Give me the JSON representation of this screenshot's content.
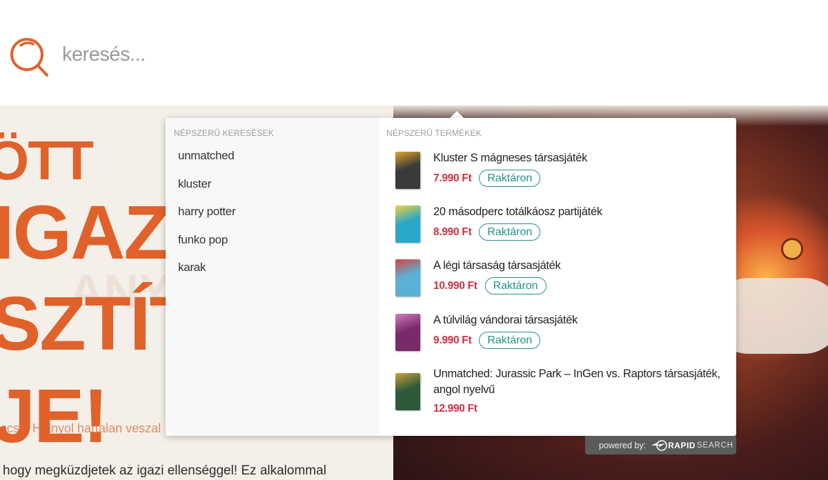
{
  "search": {
    "placeholder": "keresés..."
  },
  "hero": {
    "line1": "ÖTT",
    "line2": "IGAZI",
    "line3": "SZTÍTA",
    "line4": "JE!",
    "ghost": "ANY",
    "small_text": "ocsk. Hianyol hartalan veszal",
    "body_text": "hogy megküzdjetek az igazi ellenséggel! Ez alkalommal"
  },
  "dropdown": {
    "popular_searches_title": "NÉPSZERŰ KERESÉSEK",
    "popular_searches": [
      "unmatched",
      "kluster",
      "harry potter",
      "funko pop",
      "karak"
    ],
    "popular_products_title": "NÉPSZERŰ TERMÉKEK",
    "products": [
      {
        "name": "Kluster S mágneses társasjáték",
        "price": "7.990 Ft",
        "stock": "Raktáron",
        "thumb_color": "#3a3a3a",
        "thumb_accent": "#e0a52a"
      },
      {
        "name": "20 másodperc totálkáosz partijáték",
        "price": "8.990 Ft",
        "stock": "Raktáron",
        "thumb_color": "#2aa7c9",
        "thumb_accent": "#f2d23a"
      },
      {
        "name": "A légi társaság társasjáték",
        "price": "10.990 Ft",
        "stock": "Raktáron",
        "thumb_color": "#5ab0d6",
        "thumb_accent": "#d2463a"
      },
      {
        "name": "A túlvilág vándorai társasjáték",
        "price": "9.990 Ft",
        "stock": "Raktáron",
        "thumb_color": "#7a2a6a",
        "thumb_accent": "#d27ac2"
      },
      {
        "name": "Unmatched: Jurassic Park – InGen vs. Raptors társasjáték, angol nyelvű",
        "price": "12.990 Ft",
        "stock": "",
        "thumb_color": "#2e5a3a",
        "thumb_accent": "#c8a23a"
      }
    ]
  },
  "powered_by": {
    "label": "powered by:",
    "brand": "RAPID",
    "brand_suffix": "SEARCH"
  },
  "colors": {
    "accent": "#e0622a",
    "price": "#d32f3f",
    "stock": "#22918a"
  }
}
